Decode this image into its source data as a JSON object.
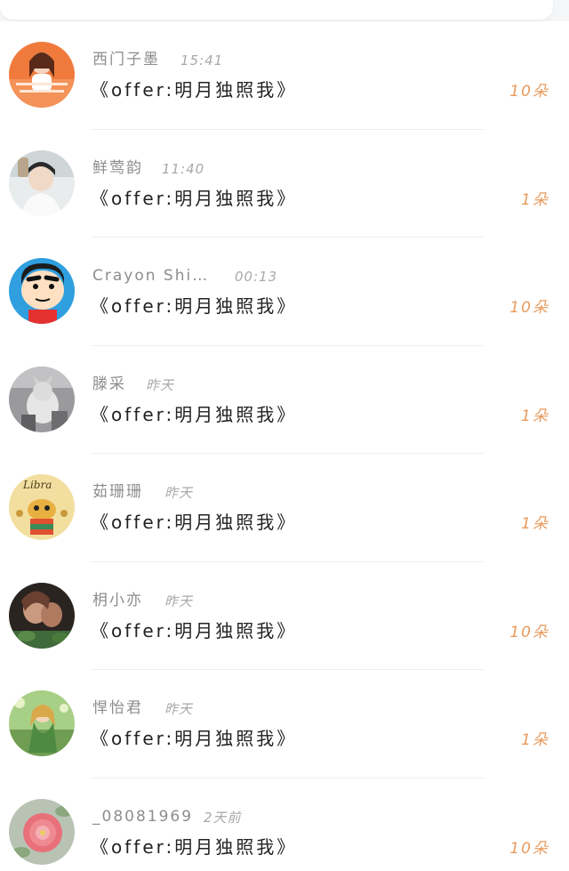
{
  "header": {
    "back_icon": "back-arrow-icon"
  },
  "accent_color": "#e89a5c",
  "link_color": "#2b9cf2",
  "list": {
    "rows": [
      {
        "name": "西门子墨",
        "time": "15:41",
        "title": "《offer:明月独照我》",
        "count": "10朵",
        "avatar": "avatar-orange-portrait"
      },
      {
        "name": "鲜莺韵",
        "time": "11:40",
        "title": "《offer:明月独照我》",
        "count": "1朵",
        "avatar": "avatar-boy-photo"
      },
      {
        "name": "Crayon Shi…",
        "time": "00:13",
        "title": "《offer:明月独照我》",
        "count": "10朵",
        "avatar": "avatar-crayon-shin-chan"
      },
      {
        "name": "滕采",
        "time": "昨天",
        "title": "《offer:明月独照我》",
        "count": "1朵",
        "avatar": "avatar-gray-cat"
      },
      {
        "name": "茹珊珊",
        "time": "昨天",
        "title": "《offer:明月独照我》",
        "count": "1朵",
        "avatar": "avatar-libra-cartoon"
      },
      {
        "name": "枂小亦",
        "time": "昨天",
        "title": "《offer:明月独照我》",
        "count": "10朵",
        "avatar": "avatar-dark-fantasy"
      },
      {
        "name": "悍怡君",
        "time": "昨天",
        "title": "《offer:明月独照我》",
        "count": "1朵",
        "avatar": "avatar-green-fairy"
      },
      {
        "name": "_08081969",
        "time": "2天前",
        "title": "《offer:明月独照我》",
        "count": "10朵",
        "avatar": "avatar-pink-flower"
      }
    ]
  }
}
